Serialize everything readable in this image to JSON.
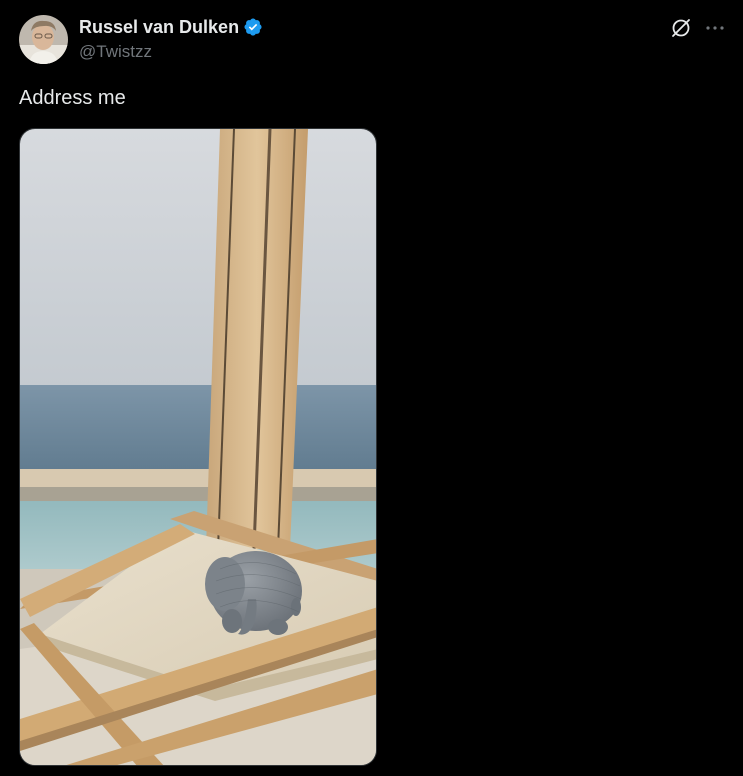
{
  "author": {
    "display_name": "Russel van Dulken",
    "handle": "@Twistzz",
    "verified": true,
    "verified_icon": "verified-badge-icon",
    "verified_color": "#1d9bf0"
  },
  "actions": {
    "grok_icon": "grok-icon",
    "more_icon": "more-options-icon"
  },
  "tweet": {
    "text": "Address me"
  },
  "colors": {
    "background": "#000000",
    "text_primary": "#e7e9ea",
    "text_secondary": "#71767b"
  }
}
